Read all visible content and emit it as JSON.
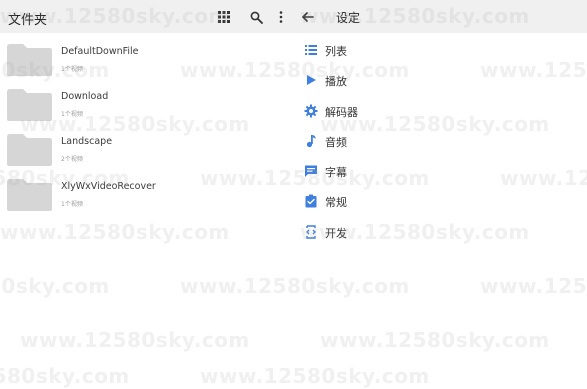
{
  "left": {
    "title": "文件夹",
    "icons": {
      "grid": "grid-view-icon",
      "search": "search-icon",
      "more": "more-vert-icon"
    },
    "folders": [
      {
        "name": "DefaultDownFile",
        "count": "1个视频"
      },
      {
        "name": "Download",
        "count": "1个视频"
      },
      {
        "name": "Landscape",
        "count": "2个视频"
      },
      {
        "name": "XlyWxVideoRecover",
        "count": "1个视频"
      }
    ]
  },
  "right": {
    "title": "设定",
    "back_icon": "arrow-back-icon",
    "items": [
      {
        "label": "列表",
        "icon": "list-icon"
      },
      {
        "label": "播放",
        "icon": "play-icon"
      },
      {
        "label": "解码器",
        "icon": "gear-icon"
      },
      {
        "label": "音频",
        "icon": "music-note-icon"
      },
      {
        "label": "字幕",
        "icon": "subtitles-icon"
      },
      {
        "label": "常规",
        "icon": "clipboard-check-icon"
      },
      {
        "label": "开发",
        "icon": "developer-code-icon"
      }
    ]
  },
  "watermark": "www.12580sky.com",
  "colors": {
    "accent": "#3f7fe0",
    "header_bg": "#f0f0f0",
    "folder": "#d6d6d6"
  }
}
